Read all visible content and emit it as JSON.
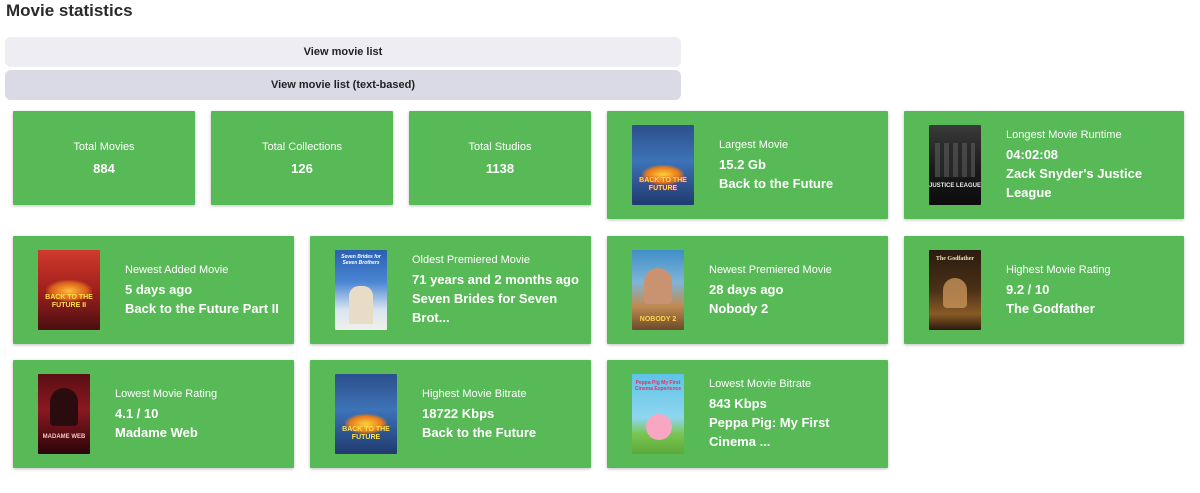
{
  "header": {
    "title": "Movie statistics"
  },
  "buttons": {
    "view_list": "View movie list",
    "view_list_text": "View movie list (text-based)"
  },
  "cards": {
    "total_movies": {
      "label": "Total Movies",
      "value": "884"
    },
    "total_collections": {
      "label": "Total Collections",
      "value": "126"
    },
    "total_studios": {
      "label": "Total Studios",
      "value": "1138"
    },
    "largest_movie": {
      "label": "Largest Movie",
      "value": "15.2 Gb",
      "title": "Back to the Future",
      "poster_text": "BACK TO THE FUTURE"
    },
    "longest_runtime": {
      "label": "Longest Movie Runtime",
      "value": "04:02:08",
      "title": "Zack Snyder's Justice League",
      "poster_text": "JUSTICE LEAGUE"
    },
    "newest_added": {
      "label": "Newest Added Movie",
      "value": "5 days ago",
      "title": "Back to the Future Part II",
      "poster_text": "BACK TO THE FUTURE II"
    },
    "oldest_premiered": {
      "label": "Oldest Premiered Movie",
      "value": "71 years and 2 months ago",
      "title": "Seven Brides for Seven Brot...",
      "poster_text": "Seven Brides for Seven Brothers"
    },
    "newest_premiered": {
      "label": "Newest Premiered Movie",
      "value": "28 days ago",
      "title": "Nobody 2",
      "poster_text": "NOBODY 2"
    },
    "highest_rating": {
      "label": "Highest Movie Rating",
      "value": "9.2 / 10",
      "title": "The Godfather",
      "poster_text": "The Godfather"
    },
    "lowest_rating": {
      "label": "Lowest Movie Rating",
      "value": "4.1 / 10",
      "title": "Madame Web",
      "poster_text": "MADAME WEB"
    },
    "highest_bitrate": {
      "label": "Highest Movie Bitrate",
      "value": "18722 Kbps",
      "title": "Back to the Future",
      "poster_text": "BACK TO THE FUTURE"
    },
    "lowest_bitrate": {
      "label": "Lowest Movie Bitrate",
      "value": "843 Kbps",
      "title": "Peppa Pig: My First Cinema ...",
      "poster_text": "Peppa Pig My First Cinema Experience"
    }
  },
  "colors": {
    "card_bg": "#58b957",
    "btn1_bg": "#eeedf4",
    "btn2_bg": "#dad9e6"
  }
}
